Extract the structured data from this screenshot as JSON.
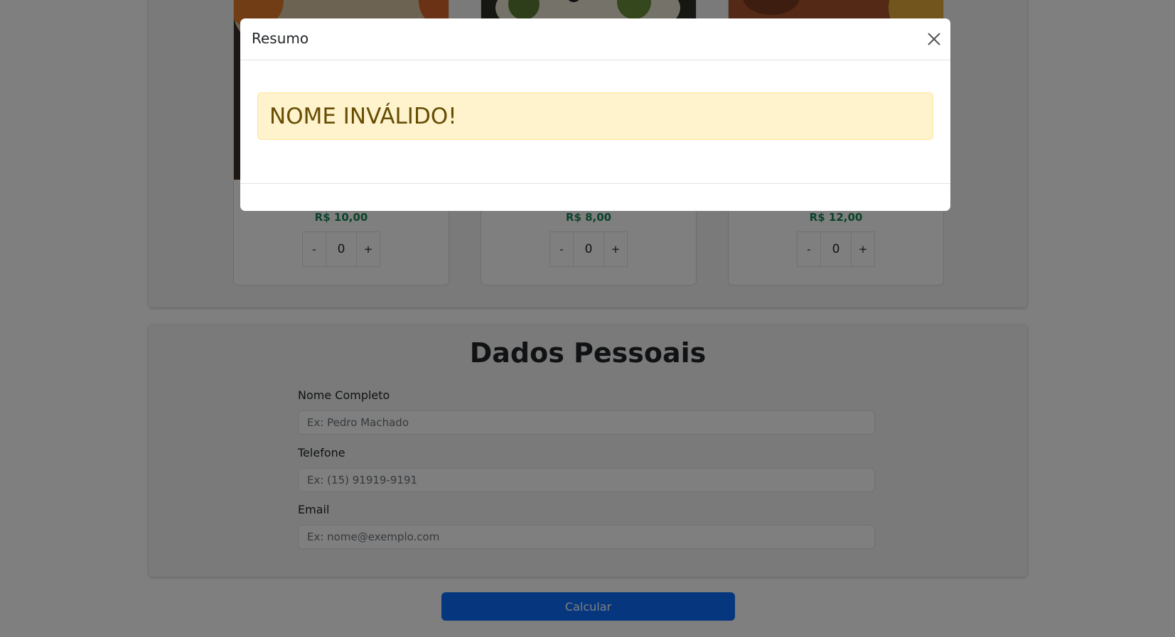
{
  "products": [
    {
      "price": "R$ 10,00",
      "minus": "-",
      "quantity": "0",
      "plus": "+",
      "image": "food-photo"
    },
    {
      "price": "R$ 8,00",
      "minus": "-",
      "quantity": "0",
      "plus": "+",
      "image": "food-photo"
    },
    {
      "price": "R$ 12,00",
      "minus": "-",
      "quantity": "0",
      "plus": "+",
      "image": "food-photo"
    }
  ],
  "personal": {
    "title": "Dados Pessoais",
    "name_label": "Nome Completo",
    "name_placeholder": "Ex: Pedro Machado",
    "phone_label": "Telefone",
    "phone_placeholder": "Ex: (15) 91919-9191",
    "email_label": "Email",
    "email_placeholder": "Ex: nome@exemplo.com"
  },
  "calculate_label": "Calcular",
  "modal": {
    "title": "Resumo",
    "alert": "NOME INVÁLIDO!",
    "close_icon": "close-icon"
  },
  "colors": {
    "price": "#198754",
    "primary": "#0d6efd",
    "alert_bg": "#fff3cd",
    "alert_text": "#664d03"
  }
}
